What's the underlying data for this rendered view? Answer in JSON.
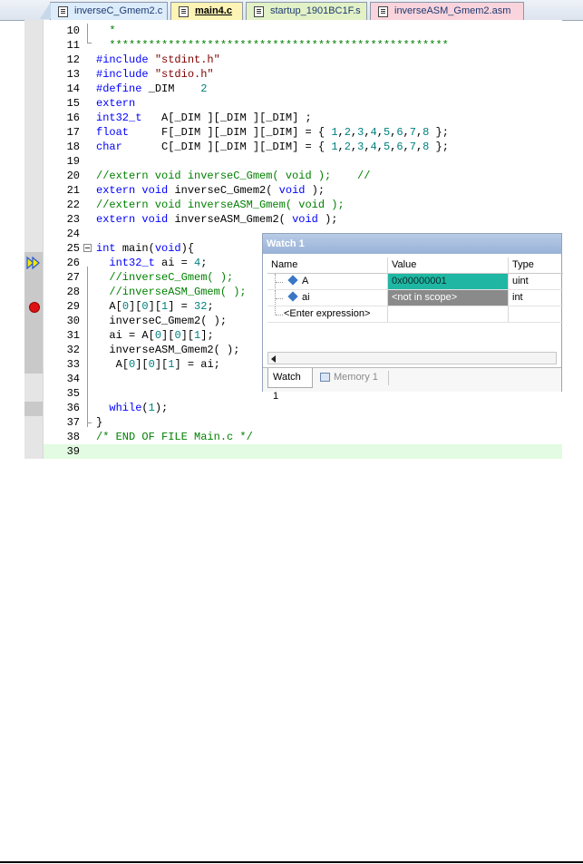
{
  "tabs": [
    {
      "label": "inverseC_Gmem2.c",
      "active": false
    },
    {
      "label": "main4.c",
      "active": true
    },
    {
      "label": "startup_1901BC1F.s",
      "active": false
    },
    {
      "label": "inverseASM_Gmem2.asm",
      "active": false
    }
  ],
  "editor": {
    "lines": [
      {
        "n": "10",
        "t": "  *"
      },
      {
        "n": "11",
        "t": "  ****************************************************"
      },
      {
        "n": "12",
        "t": "#include \"stdint.h\""
      },
      {
        "n": "13",
        "t": "#include \"stdio.h\""
      },
      {
        "n": "14",
        "t": "#define _DIM    2"
      },
      {
        "n": "15",
        "t": "extern"
      },
      {
        "n": "16",
        "t": "int32_t   A[_DIM ][_DIM ][_DIM] ;"
      },
      {
        "n": "17",
        "t": "float     F[_DIM ][_DIM ][_DIM] = { 1,2,3,4,5,6,7,8 };"
      },
      {
        "n": "18",
        "t": "char      C[_DIM ][_DIM ][_DIM] = { 1,2,3,4,5,6,7,8 };"
      },
      {
        "n": "19",
        "t": ""
      },
      {
        "n": "20",
        "t": "//extern void inverseC_Gmem( void );    //"
      },
      {
        "n": "21",
        "t": "extern void inverseC_Gmem2( void );"
      },
      {
        "n": "22",
        "t": "//extern void inverseASM_Gmem( void );"
      },
      {
        "n": "23",
        "t": "extern void inverseASM_Gmem2( void );"
      },
      {
        "n": "24",
        "t": ""
      },
      {
        "n": "25",
        "t": "int main(void){"
      },
      {
        "n": "26",
        "t": "  int32_t ai = 4;"
      },
      {
        "n": "27",
        "t": "  //inverseC_Gmem( );"
      },
      {
        "n": "28",
        "t": "  //inverseASM_Gmem( );"
      },
      {
        "n": "29",
        "t": "  A[0][0][1] = 32;"
      },
      {
        "n": "30",
        "t": "  inverseC_Gmem2( );"
      },
      {
        "n": "31",
        "t": "  ai = A[0][0][1];"
      },
      {
        "n": "32",
        "t": "  inverseASM_Gmem2( );"
      },
      {
        "n": "33",
        "t": "   A[0][0][1] = ai;"
      },
      {
        "n": "34",
        "t": ""
      },
      {
        "n": "35",
        "t": ""
      },
      {
        "n": "36",
        "t": "  while(1);"
      },
      {
        "n": "37",
        "t": "}"
      },
      {
        "n": "38",
        "t": "/* END OF FILE Main.c */"
      },
      {
        "n": "39",
        "t": ""
      }
    ]
  },
  "watch": {
    "title": "Watch 1",
    "columns": {
      "name": "Name",
      "value": "Value",
      "type": "Type"
    },
    "rows": [
      {
        "name": "A",
        "value": "0x00000001",
        "type": "uint"
      },
      {
        "name": "ai",
        "value": "<not in scope>",
        "type": "int"
      }
    ],
    "enter_expression": "<Enter expression>",
    "tabs": {
      "watch": "Watch 1",
      "memory": "Memory 1"
    }
  },
  "colors": {
    "changed_value": "#1fb7a3",
    "not_in_scope": "#8a8a8a",
    "breakpoint": "#dd1111",
    "current_line_arrow": "#f5e600"
  }
}
